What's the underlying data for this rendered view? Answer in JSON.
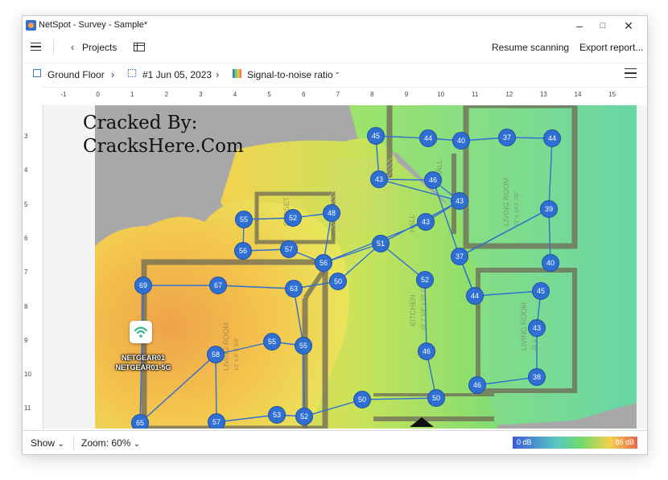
{
  "window": {
    "title": "NetSpot - Survey - Sample*"
  },
  "toolbar": {
    "projects_label": "Projects",
    "resume_label": "Resume scanning",
    "export_label": "Export report..."
  },
  "breadcrumbs": {
    "floor": "Ground Floor",
    "survey": "#1 Jun 05, 2023",
    "visualization": "Signal-to-noise ratio"
  },
  "ruler": {
    "x_labels": [
      "-1",
      "0",
      "1",
      "2",
      "3",
      "4",
      "5",
      "6",
      "7",
      "8",
      "9",
      "10",
      "11",
      "12",
      "13",
      "14",
      "15"
    ],
    "y_labels": [
      "3",
      "4",
      "5",
      "6",
      "7",
      "8",
      "9",
      "10",
      "11"
    ]
  },
  "watermark": {
    "line1": "Cracked By:",
    "line2": "CracksHere.Com"
  },
  "router": {
    "ssid1": "NETGEAR01",
    "ssid2": "NETGEAR01-5G"
  },
  "room_labels": {
    "closet": "CLOSET",
    "hall1": "HALL",
    "hall2": "HALL",
    "living_room_1": "LIVING ROOM",
    "living_room_1_dims": "11' x 14'2 7/8\"",
    "living_room_2": "LIVING ROOM",
    "living_room_2_dims": "11' x 14' 3/4\"",
    "living_room_3": "LIVING ROOM",
    "living_room_3_dims": "15' x 6' 3 3/4\"",
    "kitchen": "KITCHEN",
    "kitchen_dims": "16' 7 1/4\" x 16' 2 1/4\""
  },
  "survey_points": [
    45,
    44,
    40,
    37,
    44,
    43,
    46,
    43,
    39,
    55,
    52,
    48,
    43,
    56,
    57,
    56,
    51,
    37,
    40,
    69,
    67,
    63,
    50,
    52,
    44,
    45,
    43,
    55,
    55,
    58,
    46,
    46,
    38,
    50,
    50,
    52,
    53,
    57,
    65
  ],
  "statusbar": {
    "show_label": "Show",
    "zoom_label": "Zoom: 60%",
    "legend_min": "0 dB",
    "legend_max": "86 dB"
  },
  "colors": {
    "accent": "#3a6fd8",
    "point_fill": "#2f6fd1",
    "heat_low": "#3b5bdb",
    "heat_high": "#e8674a"
  },
  "icons": [
    "app-icon",
    "minimize-icon",
    "maximize-icon",
    "close-icon",
    "menu-icon",
    "chevron-left-icon",
    "sidebar-panel-icon",
    "floor-icon",
    "survey-icon",
    "snr-icon",
    "chevron-right-icon",
    "chevron-down-icon",
    "filter-icon",
    "wifi-icon"
  ]
}
